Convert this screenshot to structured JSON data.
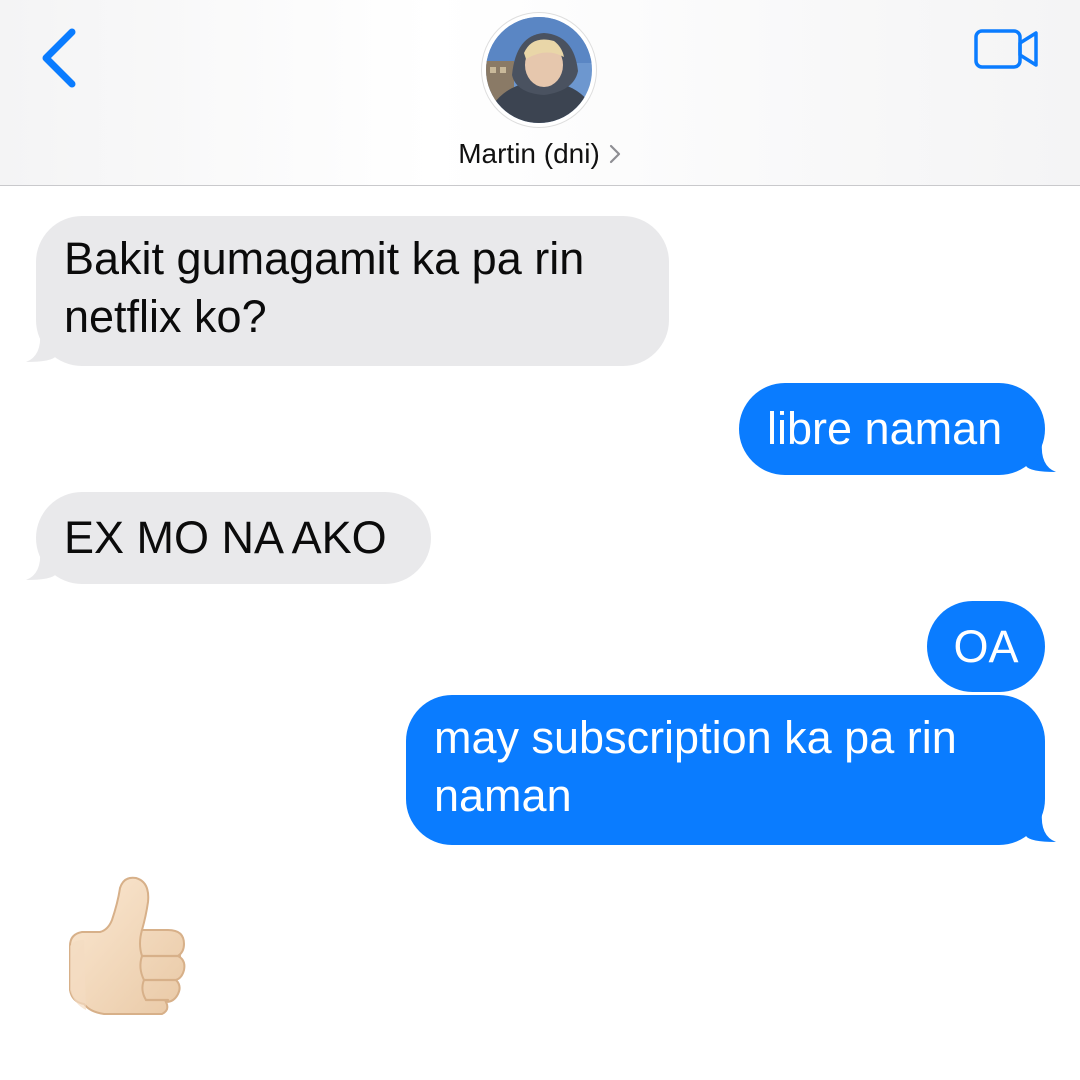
{
  "header": {
    "contact_name": "Martin (dni)",
    "back_icon": "chevron-left-icon",
    "video_icon": "video-camera-icon",
    "avatar": "contact-photo",
    "accent_color": "#0a7cff"
  },
  "messages": [
    {
      "direction": "incoming",
      "text": "Bakit gumagamit ka pa rin\nnetflix ko?"
    },
    {
      "direction": "outgoing",
      "text": "libre naman"
    },
    {
      "direction": "incoming",
      "text": "EX MO NA AKO"
    },
    {
      "direction": "outgoing",
      "text": "OA"
    },
    {
      "direction": "outgoing",
      "text": "may subscription ka pa rin\nnaman"
    },
    {
      "direction": "incoming",
      "emoji": "thumbs-up-icon"
    }
  ],
  "colors": {
    "incoming_bubble": "#e9e9eb",
    "outgoing_bubble": "#0a7cff"
  }
}
